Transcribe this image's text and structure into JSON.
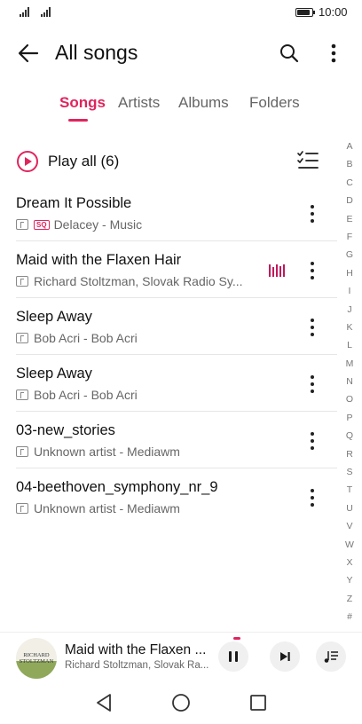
{
  "status_bar": {
    "time": "10:00",
    "battery_level": 0.9
  },
  "header": {
    "title": "All songs",
    "back_icon": "back-arrow-icon",
    "search_icon": "search-icon",
    "more_icon": "more-vertical-icon"
  },
  "tabs": [
    {
      "label": "Songs",
      "active": true
    },
    {
      "label": "Artists",
      "active": false
    },
    {
      "label": "Albums",
      "active": false
    },
    {
      "label": "Folders",
      "active": false
    }
  ],
  "play_all": {
    "label": "Play all (6)",
    "icon": "play-circle-icon",
    "multi_select_icon": "checklist-icon"
  },
  "songs": [
    {
      "title": "Dream It Possible",
      "subtitle": "Delacey - Music",
      "sq_badge": "SQ",
      "playing": false
    },
    {
      "title": "Maid with the Flaxen Hair",
      "subtitle": "Richard Stoltzman, Slovak Radio Sy...",
      "sq_badge": "",
      "playing": true
    },
    {
      "title": "Sleep Away",
      "subtitle": "Bob Acri - Bob Acri",
      "sq_badge": "",
      "playing": false
    },
    {
      "title": "Sleep Away",
      "subtitle": "Bob Acri - Bob Acri",
      "sq_badge": "",
      "playing": false
    },
    {
      "title": "03-new_stories",
      "subtitle": "Unknown artist - Mediawm",
      "sq_badge": "",
      "playing": false
    },
    {
      "title": "04-beethoven_symphony_nr_9",
      "subtitle": "Unknown artist - Mediawm",
      "sq_badge": "",
      "playing": false
    }
  ],
  "alpha_index": [
    "A",
    "B",
    "C",
    "D",
    "E",
    "F",
    "G",
    "H",
    "I",
    "J",
    "K",
    "L",
    "M",
    "N",
    "O",
    "P",
    "Q",
    "R",
    "S",
    "T",
    "U",
    "V",
    "W",
    "X",
    "Y",
    "Z",
    "#"
  ],
  "mini_player": {
    "title": "Maid with the Flaxen ...",
    "artist": "Richard Stoltzman, Slovak Ra...",
    "album_art_text": "RICHARD STOLTZMAN",
    "pause_icon": "pause-icon",
    "next_icon": "skip-next-icon",
    "queue_icon": "playlist-icon"
  },
  "colors": {
    "accent": "#e0245e",
    "text_primary": "#111111",
    "text_secondary": "#666666"
  },
  "nav_bar": {
    "back_icon": "nav-back-triangle-icon",
    "home_icon": "nav-home-circle-icon",
    "recents_icon": "nav-recents-square-icon"
  }
}
